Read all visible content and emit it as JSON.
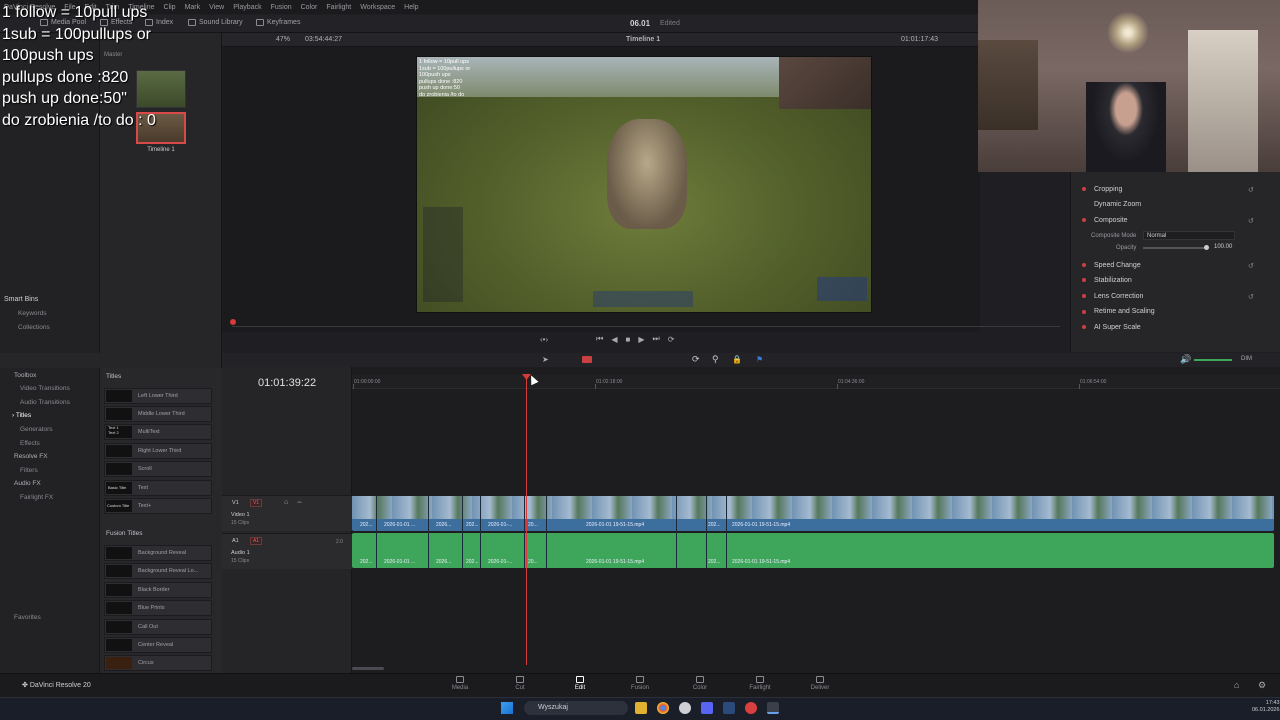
{
  "overlay_text": "1 follow = 10pull ups\n1sub = 100pullups or\n100push ups\npullups done :820\npush up done:50\"\ndo zrobienia /to do : 0",
  "menu": [
    "DaVinci Resolve",
    "File",
    "Edit",
    "Trim",
    "Timeline",
    "Clip",
    "Mark",
    "View",
    "Playback",
    "Fusion",
    "Color",
    "Fairlight",
    "Workspace",
    "Help"
  ],
  "toolbar": {
    "media_pool": "Media Pool",
    "effects": "Effects",
    "index": "Index",
    "sound_library": "Sound Library",
    "keyframes": "Keyframes",
    "project_title": "06.01",
    "project_state": "Edited"
  },
  "viewer": {
    "zoom": "47%",
    "duration": "03:54:44:27",
    "timeline_name": "Timeline 1",
    "timecode": "01:01:17:43"
  },
  "media_pool": {
    "master": "Master",
    "clip_label": "Timeline 1"
  },
  "smart_bins": {
    "title": "Smart Bins",
    "items": [
      "Keywords",
      "Collections"
    ]
  },
  "video_overlay": "1 follow = 10pull ups\n1sub = 100pullups or\n100push ups\npullups done :820\npush up done:50\ndo zrobienia /to do",
  "inspector": {
    "cropping": "Cropping",
    "dynamic_zoom": "Dynamic Zoom",
    "composite": "Composite",
    "composite_mode_label": "Composite Mode",
    "composite_mode_value": "Normal",
    "opacity_label": "Opacity",
    "opacity_value": "100.00",
    "speed_change": "Speed Change",
    "stabilization": "Stabilization",
    "lens_correction": "Lens Correction",
    "retime_scaling": "Retime and Scaling",
    "ai_super_scale": "AI Super Scale"
  },
  "effects_sidebar": {
    "toolbox": "Toolbox",
    "video_transitions": "Video Transitions",
    "audio_transitions": "Audio Transitions",
    "titles": "Titles",
    "generators": "Generators",
    "effects": "Effects",
    "resolve_fx": "Resolve FX",
    "filters": "Filters",
    "audio_fx": "Audio FX",
    "fairlight_fx": "Fairlight FX",
    "favorites": "Favorites"
  },
  "titles_list": {
    "header": "Titles",
    "items": [
      "Left Lower Third",
      "Middle Lower Third",
      "MultiText",
      "Right Lower Third",
      "Scroll",
      "Text",
      "Text+"
    ],
    "thumb_text": [
      "",
      "",
      "Text 1\nText 2",
      "",
      "",
      "Basic Title",
      "Custom Title"
    ]
  },
  "fusion_titles": {
    "header": "Fusion Titles",
    "items": [
      "Background Reveal",
      "Background Reveal Lo...",
      "Black Border",
      "Blue Prints",
      "Call Out",
      "Center Reveal",
      "Circus"
    ]
  },
  "timeline": {
    "timecode": "01:01:39:22",
    "ruler": [
      "01:00:00:00",
      "01:02:18:00",
      "01:04:36:00",
      "01:06:54:00"
    ],
    "v1_name": "Video 1",
    "v1_clips": "15 Clips",
    "a1_name": "Audio 1",
    "a1_clips": "15 Clips",
    "v1_tag": "V1",
    "a1_tag": "A1",
    "a1_level": "2.0",
    "clip_labels": [
      "202...",
      "2026-01-01 ...",
      "2026...",
      "202...",
      "2026-01-...",
      "20...",
      "2026-01-01 19-51-15.mp4",
      "202...",
      "2026-01-01 19-51-15.mp4"
    ],
    "audio_dim": "DIM"
  },
  "pages": [
    "Media",
    "Cut",
    "Edit",
    "Fusion",
    "Color",
    "Fairlight",
    "Deliver"
  ],
  "active_page": "Edit",
  "brand": "DaVinci Resolve 20",
  "taskbar": {
    "search": "Wyszukaj",
    "time": "17:43",
    "date": "06.01.2026"
  },
  "colors": {
    "accent_red": "#d83a3a",
    "video_clip": "#3d6f9e",
    "audio_clip": "#3ea65a"
  }
}
